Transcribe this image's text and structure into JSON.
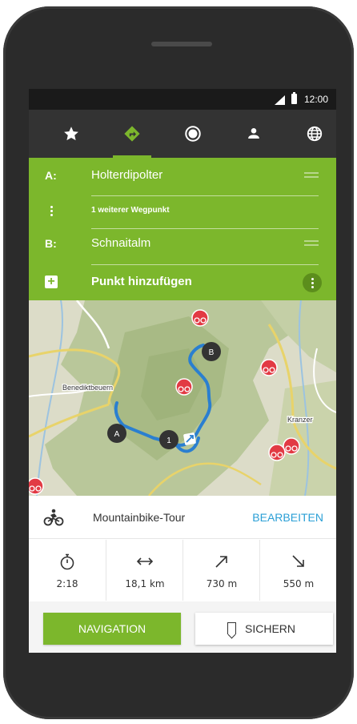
{
  "status_bar": {
    "time": "12:00"
  },
  "tabs": [
    {
      "icon": "star-icon",
      "active": false
    },
    {
      "icon": "route-icon",
      "active": true
    },
    {
      "icon": "target-icon",
      "active": false
    },
    {
      "icon": "person-icon",
      "active": false
    },
    {
      "icon": "globe-icon",
      "active": false
    }
  ],
  "route": {
    "start_key": "A:",
    "start_value": "Holterdipolter",
    "waypoint_value": "1 weiterer Wegpunkt",
    "end_key": "B:",
    "end_value": "Schnaitalm",
    "add_label": "Punkt hinzufügen"
  },
  "map": {
    "place_benediktbeuern": "Benediktbeuern",
    "place_kranzer": "Kranzer",
    "marker_a": "A",
    "marker_b": "B",
    "marker_waypoint": "1"
  },
  "tour": {
    "type": "Mountainbike-Tour",
    "edit_label": "BEARBEITEN"
  },
  "stats": {
    "duration": "2:18",
    "distance": "18,1 km",
    "ascent": "730 m",
    "descent": "550 m"
  },
  "actions": {
    "navigation_label": "NAVIGATION",
    "save_label": "SICHERN"
  },
  "colors": {
    "accent": "#7cb72c",
    "link": "#2a9fd6",
    "route_line": "#2a7fd0",
    "poi": "#e23a44"
  }
}
